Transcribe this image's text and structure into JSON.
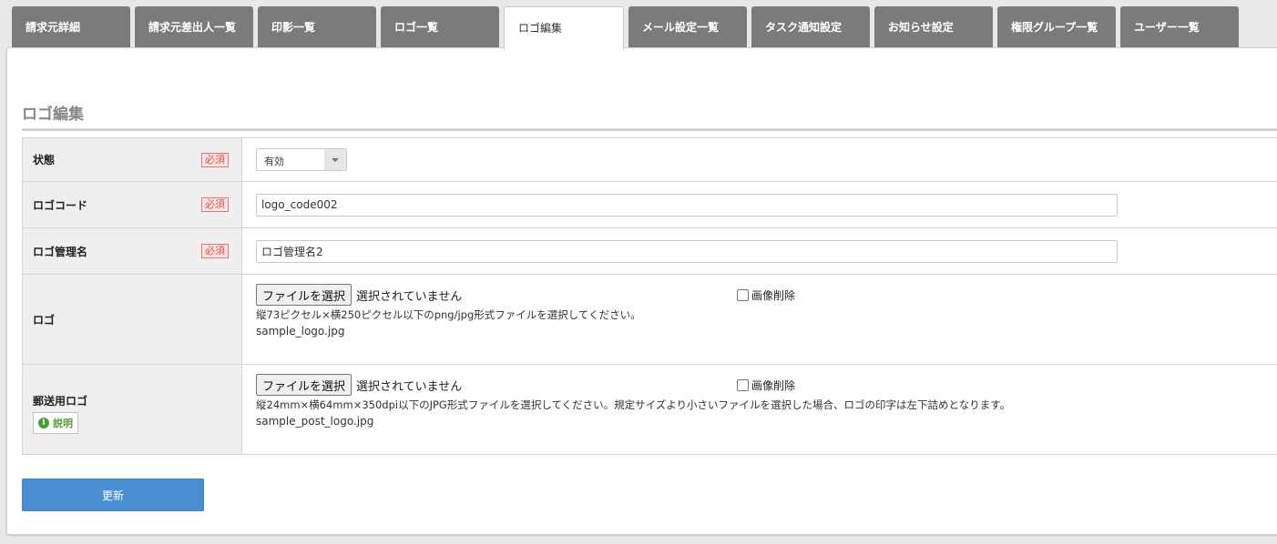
{
  "tabs": [
    {
      "label": "請求元詳細",
      "width": 130
    },
    {
      "label": "請求元差出人一覧",
      "width": 130
    },
    {
      "label": "印影一覧",
      "width": 130
    },
    {
      "label": "ロゴ一覧",
      "width": 130
    },
    {
      "label": "ロゴ編集",
      "width": 132
    },
    {
      "label": "メール設定一覧",
      "width": 130
    },
    {
      "label": "タスク通知設定",
      "width": 130
    },
    {
      "label": "お知らせ設定",
      "width": 130
    },
    {
      "label": "権限グループ一覧",
      "width": 130
    },
    {
      "label": "ユーザー一覧",
      "width": 130
    }
  ],
  "active_tab": "ロゴ編集",
  "section_title": "ロゴ編集",
  "required_label": "必須",
  "form": {
    "status": {
      "label": "状態",
      "value": "有効"
    },
    "logo_code": {
      "label": "ロゴコード",
      "value": "logo_code002"
    },
    "logo_name": {
      "label": "ロゴ管理名",
      "value": "ロゴ管理名2"
    },
    "logo": {
      "label": "ロゴ",
      "file_button": "ファイルを選択",
      "file_status": "選択されていません",
      "delete_label": "画像削除",
      "hint": "縦73ピクセル×横250ピクセル以下のpng/jpg形式ファイルを選択してください。",
      "filename": "sample_logo.jpg"
    },
    "post_logo": {
      "label": "郵送用ロゴ",
      "help_label": "説明",
      "file_button": "ファイルを選択",
      "file_status": "選択されていません",
      "delete_label": "画像削除",
      "hint": "縦24mm×横64mm×350dpi以下のJPG形式ファイルを選択してください。規定サイズより小さいファイルを選択した場合、ロゴの印字は左下詰めとなります。",
      "filename": "sample_post_logo.jpg"
    }
  },
  "submit_label": "更新"
}
